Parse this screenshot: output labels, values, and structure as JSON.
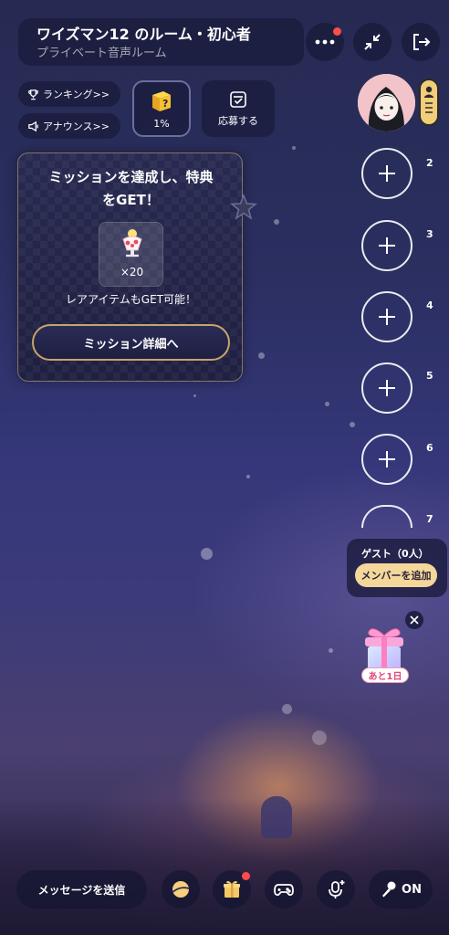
{
  "room": {
    "title": "ワイズマン12 のルーム・初心者",
    "subtitle": "プライベート音声ルーム"
  },
  "header_icons": [
    "more-icon",
    "collapse-icon",
    "exit-icon"
  ],
  "chips": {
    "ranking": "ランキング>>",
    "announce": "アナウンス>>",
    "progress": "1%",
    "apply": "応募する"
  },
  "mission": {
    "title_line1": "ミッションを達成し、特典",
    "title_line2": "をGET！",
    "item_count": "×20",
    "note": "レアアイテムもGET可能！",
    "button": "ミッション詳細へ"
  },
  "seats": [
    {
      "num": "2"
    },
    {
      "num": "3"
    },
    {
      "num": "4"
    },
    {
      "num": "5"
    },
    {
      "num": "6"
    },
    {
      "num": "7"
    }
  ],
  "guest": {
    "label": "ゲスト（0人）",
    "add_button": "メンバーを追加"
  },
  "gift_event": {
    "countdown": "あと1日"
  },
  "bottom_bar": {
    "message": "メッセージを送信",
    "mic_state": "ON"
  },
  "colors": {
    "accent_gold": "#c9a46a",
    "add_member_bg": "#f3d79b",
    "notification_red": "#ff4b4b"
  }
}
